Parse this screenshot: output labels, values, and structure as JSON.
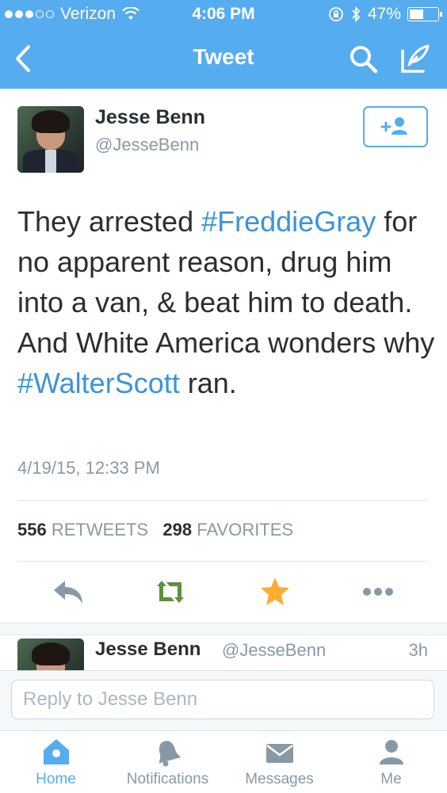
{
  "status_bar": {
    "carrier": "Verizon",
    "time": "4:06 PM",
    "battery": "47%"
  },
  "nav": {
    "title": "Tweet"
  },
  "tweet": {
    "author_name": "Jesse Benn",
    "author_handle": "@JesseBenn",
    "text_parts": {
      "p1": "They arrested ",
      "h1": "#FreddieGray",
      "p2": " for no apparent reason, drug him into a van, & beat him to death. And White America wonders why ",
      "h2": "#WalterScott",
      "p3": " ran."
    },
    "timestamp": "4/19/15, 12:33 PM",
    "retweets_count": "556",
    "retweets_label": "RETWEETS",
    "favorites_count": "298",
    "favorites_label": "FAVORITES"
  },
  "reply_preview": {
    "author_name": "Jesse Benn",
    "author_handle": "@JesseBenn",
    "age": "3h"
  },
  "reply_box": {
    "placeholder": "Reply to Jesse Benn"
  },
  "tabs": [
    {
      "label": "Home"
    },
    {
      "label": "Notifications"
    },
    {
      "label": "Messages"
    },
    {
      "label": "Me"
    }
  ],
  "colors": {
    "brand": "#55acee",
    "link": "#3b94d9",
    "retweet": "#5c913b",
    "favorite": "#ffac33",
    "muted": "#8899a6"
  }
}
